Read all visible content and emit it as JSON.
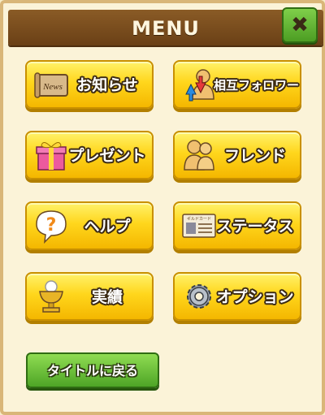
{
  "header": {
    "title": "MENU",
    "close_icon": "close-x-icon"
  },
  "menu": {
    "items": [
      {
        "id": "news",
        "label": "お知らせ",
        "icon": "news-scroll-icon"
      },
      {
        "id": "follow",
        "label": "相互フォロワー",
        "icon": "mutual-follower-icon"
      },
      {
        "id": "present",
        "label": "プレゼント",
        "icon": "gift-box-icon"
      },
      {
        "id": "friend",
        "label": "フレンド",
        "icon": "friends-icon"
      },
      {
        "id": "help",
        "label": "ヘルプ",
        "icon": "help-bubble-icon"
      },
      {
        "id": "status",
        "label": "ステータス",
        "icon": "status-card-icon"
      },
      {
        "id": "achievements",
        "label": "実績",
        "icon": "trophy-icon"
      },
      {
        "id": "options",
        "label": "オプション",
        "icon": "gear-icon"
      }
    ],
    "news_icon_text": "News",
    "status_icon_text": "ギルドカード"
  },
  "footer": {
    "back_label": "タイトルに戻る"
  },
  "colors": {
    "header_bg": "#7a4d1e",
    "button_yellow": "#ffd61c",
    "button_green": "#4ea526",
    "panel_bg": "#fbf3d8"
  }
}
